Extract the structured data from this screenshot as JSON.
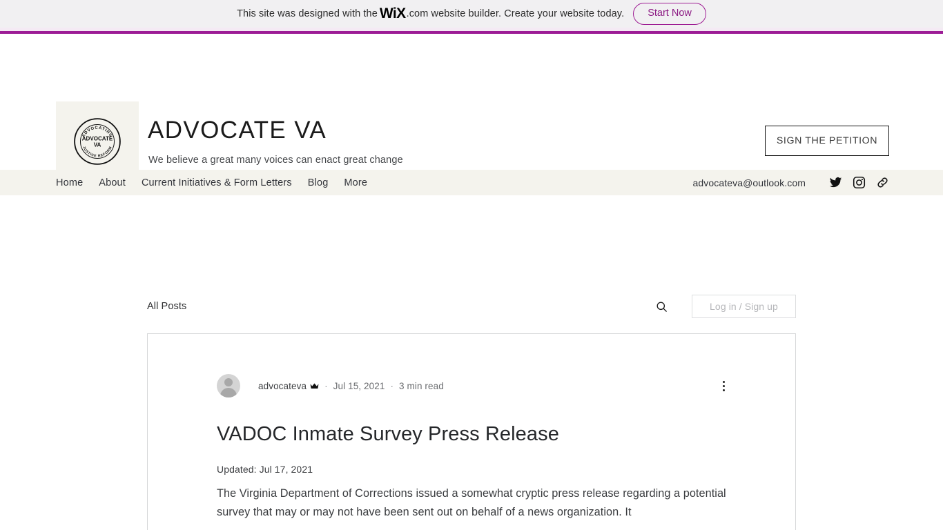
{
  "promo_banner": {
    "text_before": "This site was designed with the",
    "wix_mark": "WiX",
    "text_after": ".com website builder. Create your website today.",
    "cta_label": "Start Now",
    "accent_color": "#9d1d96"
  },
  "header": {
    "logo": {
      "top_arc_text": "ADVOCATING",
      "center_line1": "ADVOCATE",
      "center_line2": "VA",
      "bottom_arc_text": "JUSTICE REFORM"
    },
    "site_title": "ADVOCATE VA",
    "tagline": "We believe a great many voices can enact great change",
    "petition_button_label": "SIGN THE PETITION"
  },
  "nav": {
    "items": [
      {
        "label": "Home"
      },
      {
        "label": "About"
      },
      {
        "label": "Current Initiatives & Form Letters"
      },
      {
        "label": "Blog"
      },
      {
        "label": "More"
      }
    ],
    "email": "advocateva@outlook.com",
    "social": [
      {
        "name": "twitter-icon"
      },
      {
        "name": "instagram-icon"
      },
      {
        "name": "link-icon"
      }
    ]
  },
  "blog": {
    "filter_label": "All Posts",
    "search_icon": "search-icon",
    "login_label": "Log in / Sign up",
    "post": {
      "author": "advocateva",
      "author_badge": "admin-crown-icon",
      "date": "Jul 15, 2021",
      "read_time": "3 min read",
      "separator": "·",
      "title": "VADOC Inmate Survey Press Release",
      "updated": "Updated: Jul 17, 2021",
      "body": "The Virginia Department of Corrections issued a somewhat cryptic press release regarding a potential survey that may or may not have been sent out on behalf of a news organization. It",
      "menu_icon": "more-options-icon"
    }
  }
}
